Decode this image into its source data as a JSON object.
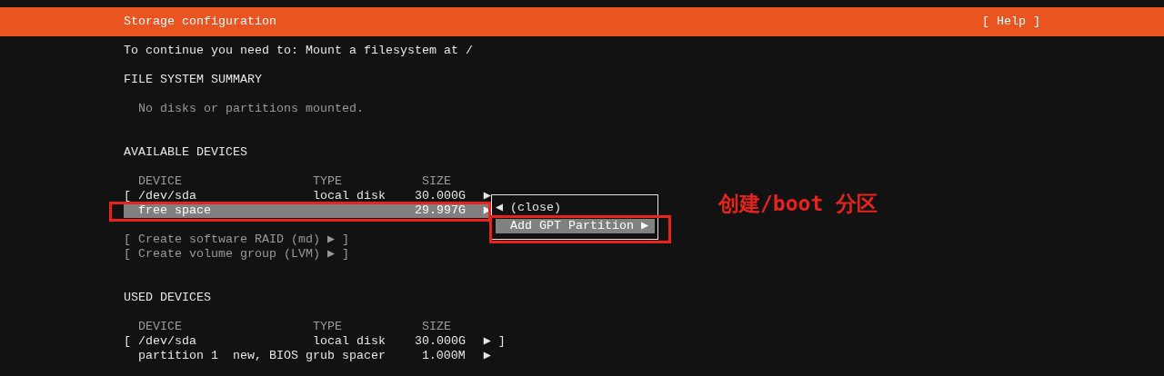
{
  "header": {
    "title": "Storage configuration",
    "help": "[ Help ]"
  },
  "instruction": "To continue you need to: Mount a filesystem at /",
  "file_system_summary": {
    "heading": "FILE SYSTEM SUMMARY",
    "empty_text": "No disks or partitions mounted."
  },
  "available_devices": {
    "heading": "AVAILABLE DEVICES",
    "columns": [
      "DEVICE",
      "TYPE",
      "SIZE"
    ],
    "rows": [
      {
        "open": "[",
        "device": "/dev/sda",
        "type": "local disk",
        "size": "30.000G",
        "arrow": "▶",
        "close": "",
        "selected": false
      },
      {
        "open": "",
        "device": "free space",
        "type": "",
        "size": "29.997G",
        "arrow": "▶",
        "close": "",
        "selected": true
      }
    ],
    "actions": [
      "[ Create software RAID (md) ▶ ]",
      "[ Create volume group (LVM) ▶ ]"
    ],
    "menu": {
      "items": [
        {
          "label": "◀ (close)",
          "selected": false
        },
        {
          "label": "Add GPT Partition ▶",
          "selected": true
        }
      ]
    }
  },
  "used_devices": {
    "heading": "USED DEVICES",
    "columns": [
      "DEVICE",
      "TYPE",
      "SIZE"
    ],
    "rows": [
      {
        "open": "[",
        "device": "/dev/sda",
        "type": "local disk",
        "size": "30.000G",
        "arrow": "▶",
        "close": "]",
        "selected": false
      },
      {
        "open": "",
        "device": "partition 1",
        "type": "new, BIOS grub spacer",
        "size": "1.000M",
        "arrow": "▶",
        "close": "",
        "selected": false
      }
    ]
  },
  "annotation": {
    "text": "创建/boot 分区"
  }
}
